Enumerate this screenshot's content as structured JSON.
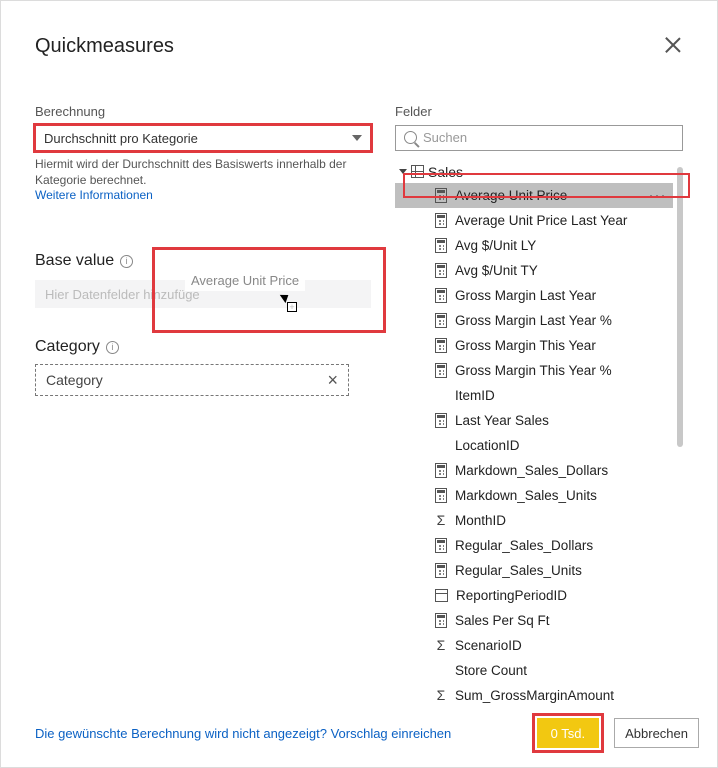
{
  "dialog": {
    "title": "Quickmeasures",
    "calculation_label": "Berechnung",
    "calculation_selected": "Durchschnitt pro Kategorie",
    "description": "Hiermit wird der Durchschnitt des Basiswerts innerhalb der Kategorie berechnet.",
    "more_info": "Weitere Informationen"
  },
  "base_value": {
    "label": "Base value",
    "placeholder": "Hier Datenfelder hinzufüge",
    "drag_ghost": "Average Unit Price"
  },
  "category": {
    "label": "Category",
    "value": "Category"
  },
  "fields": {
    "label": "Felder",
    "search_placeholder": "Suchen",
    "root": "Sales",
    "items": [
      {
        "icon": "calc",
        "label": "Average Unit Price",
        "selected": true
      },
      {
        "icon": "calc",
        "label": "Average Unit Price Last Year"
      },
      {
        "icon": "calc",
        "label": "Avg $/Unit LY"
      },
      {
        "icon": "calc",
        "label": "Avg $/Unit TY"
      },
      {
        "icon": "calc",
        "label": "Gross Margin Last Year"
      },
      {
        "icon": "calc",
        "label": "Gross Margin Last Year %"
      },
      {
        "icon": "calc",
        "label": "Gross Margin This Year"
      },
      {
        "icon": "calc",
        "label": "Gross Margin This Year %"
      },
      {
        "icon": "none",
        "label": "ItemID"
      },
      {
        "icon": "calc",
        "label": "Last Year Sales"
      },
      {
        "icon": "none",
        "label": "LocationID"
      },
      {
        "icon": "calc",
        "label": "Markdown_Sales_Dollars"
      },
      {
        "icon": "calc",
        "label": "Markdown_Sales_Units"
      },
      {
        "icon": "sigma",
        "label": "MonthID"
      },
      {
        "icon": "calc",
        "label": "Regular_Sales_Dollars"
      },
      {
        "icon": "calc",
        "label": "Regular_Sales_Units"
      },
      {
        "icon": "date",
        "label": "ReportingPeriodID"
      },
      {
        "icon": "calc",
        "label": "Sales Per Sq Ft"
      },
      {
        "icon": "sigma",
        "label": "ScenarioID"
      },
      {
        "icon": "none",
        "label": "Store Count"
      },
      {
        "icon": "sigma",
        "label": "Sum_GrossMarginAmount"
      }
    ]
  },
  "footer": {
    "suggest_link": "Die gewünschte Berechnung wird nicht angezeigt? Vorschlag einreichen",
    "ok": "0 Tsd.",
    "cancel": "Abbrechen"
  }
}
